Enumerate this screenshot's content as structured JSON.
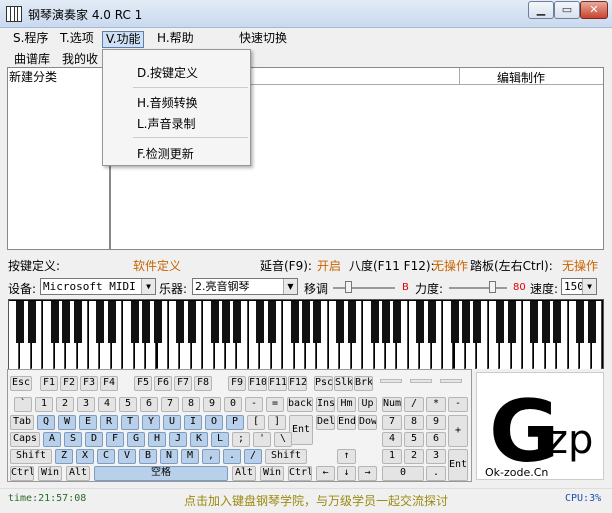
{
  "window": {
    "title": "钢琴演奏家 4.0 RC 1",
    "min_icon": "minimize-icon",
    "max_icon": "maximize-icon",
    "close_icon": "close-icon"
  },
  "menu": {
    "items": [
      "S.程序",
      "T.选项",
      "V.功能",
      "H.帮助",
      "快速切换"
    ]
  },
  "dropdown": {
    "items": [
      "D.按键定义",
      "H.音频转换",
      "L.声音录制",
      "F.检测更新"
    ]
  },
  "tabs": [
    "曲谱库",
    "我的收藏"
  ],
  "left_panel": {
    "category": "新建分类"
  },
  "right_panel": {
    "column_header": "编辑制作"
  },
  "keydef": {
    "label": "按键定义:",
    "value": "软件定义",
    "delay_label": "延音(F9):",
    "delay_value": "开启",
    "octave_label": "八度(F11 F12):",
    "octave_value": "无操作",
    "pedal_label": "踏板(左右Ctrl):",
    "pedal_value": "无操作"
  },
  "settings": {
    "device_label": "设备:",
    "device_value": "Microsoft MIDI M",
    "instrument_label": "乐器:",
    "instrument_value": "2.亮音钢琴",
    "transpose_label": "移调",
    "transpose_value": "B",
    "velocity_label": "力度:",
    "velocity_value": "80",
    "speed_label": "速度:",
    "speed_value": "150"
  },
  "keyboard": {
    "fkeys": [
      "Esc",
      "F1",
      "F2",
      "F3",
      "F4",
      "F5",
      "F6",
      "F7",
      "F8",
      "F9",
      "F10",
      "F11",
      "F12",
      "Psc",
      "Slk",
      "Brk"
    ],
    "row1": [
      "`",
      "1",
      "2",
      "3",
      "4",
      "5",
      "6",
      "7",
      "8",
      "9",
      "0",
      "-",
      "=",
      "back"
    ],
    "row2": [
      "Tab",
      "Q",
      "W",
      "E",
      "R",
      "T",
      "Y",
      "U",
      "I",
      "O",
      "P",
      "[",
      "]",
      "Ent"
    ],
    "row3": [
      "Caps",
      "A",
      "S",
      "D",
      "F",
      "G",
      "H",
      "J",
      "K",
      "L",
      ";",
      "'",
      "\\"
    ],
    "row4": [
      "Shift",
      "Z",
      "X",
      "C",
      "V",
      "B",
      "N",
      "M",
      ",",
      ".",
      "/",
      "Shift"
    ],
    "row5": [
      "Ctrl",
      "Win",
      "Alt",
      "空格",
      "Alt",
      "Win",
      "Ctrl"
    ],
    "nav1": [
      "Ins",
      "Hm",
      "Up"
    ],
    "nav2": [
      "Del",
      "End",
      "Dow"
    ],
    "arrows": [
      "↑",
      "←",
      "↓",
      "→"
    ],
    "num": [
      "Num",
      "/",
      "*",
      "-",
      "7",
      "8",
      "9",
      "+",
      "4",
      "5",
      "6",
      "1",
      "2",
      "3",
      "Ent",
      "0",
      "."
    ]
  },
  "logo": {
    "main": "G",
    "sup": "zp",
    "site": "Ok-zode.Cn"
  },
  "status": {
    "time": "time:21:57:08",
    "promo": "点击加入键盘钢琴学院，与万级学员一起交流探讨",
    "cpu": "CPU:3%"
  }
}
